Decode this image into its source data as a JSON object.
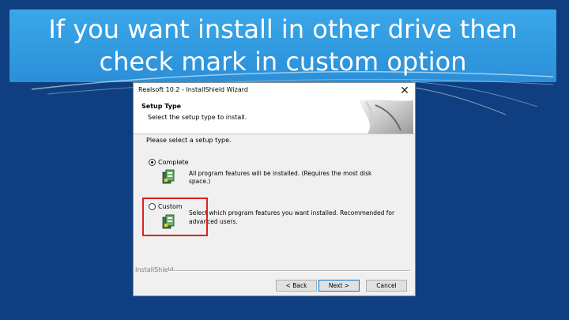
{
  "slide": {
    "title_line1": "If you want install in other drive then",
    "title_line2": "check mark in custom option"
  },
  "window": {
    "title": "Realsoft 10.2 - InstallShield Wizard",
    "close_glyph": "✕"
  },
  "header": {
    "title": "Setup Type",
    "subtitle": "Select the setup type to install."
  },
  "body": {
    "prompt": "Please select a setup type.",
    "options": [
      {
        "label": "Complete",
        "selected": true,
        "description": "All program features will be installed. (Requires the most disk space.)"
      },
      {
        "label": "Custom",
        "selected": false,
        "description_line1": "Select which program features you want installed. Recommended for",
        "description_line2": "advanced users."
      }
    ]
  },
  "footer": {
    "brand": "InstallShield",
    "back_label": "< Back",
    "next_label": "Next >",
    "cancel_label": "Cancel"
  },
  "colors": {
    "slide_background": "#0f3f80",
    "title_band": "#3aa7e9",
    "highlight": "#e02020"
  }
}
